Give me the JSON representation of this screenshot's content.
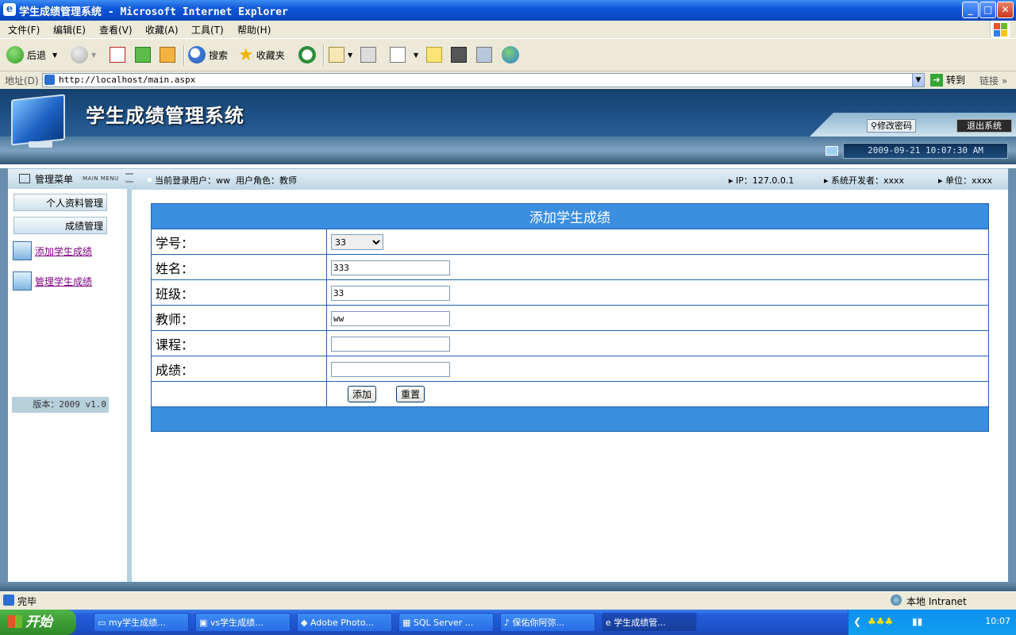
{
  "window": {
    "title": "学生成绩管理系统 - Microsoft Internet Explorer",
    "icon": "ie-icon"
  },
  "window_controls": {
    "minimize": "_",
    "maximize": "□",
    "close": "✕"
  },
  "menubar": {
    "items": [
      "文件(F)",
      "编辑(E)",
      "查看(V)",
      "收藏(A)",
      "工具(T)",
      "帮助(H)"
    ]
  },
  "toolbar": {
    "back": "后退",
    "search": "搜索",
    "favorites": "收藏夹"
  },
  "addressbar": {
    "label": "地址(D)",
    "url": "http://localhost/main.aspx",
    "go": "转到",
    "links": "链接"
  },
  "header": {
    "system_name": "学生成绩管理系统",
    "change_password": "修改密码",
    "exit": "退出系统",
    "datetime": "2009-09-21 10:07:30 AM"
  },
  "infobar": {
    "menu_title": "管理菜单",
    "menu_subtitle": "MAIN MENU",
    "current_user_label": "当前登录用户：",
    "current_user": "ww",
    "role_label": "用户角色：",
    "role": "教师",
    "ip": "IP：127.0.0.1",
    "developer": "系统开发者：xxxx",
    "unit": "单位：xxxx"
  },
  "sidebar": {
    "buttons": [
      "个人资料管理",
      "成绩管理"
    ],
    "links": [
      "添加学生成绩",
      "管理学生成绩"
    ],
    "version": "版本：2009 v1.0"
  },
  "form": {
    "title": "添加学生成绩",
    "fields": [
      {
        "label": "学号：",
        "type": "select",
        "value": "33"
      },
      {
        "label": "姓名：",
        "type": "text",
        "value": "333"
      },
      {
        "label": "班级：",
        "type": "text",
        "value": "33"
      },
      {
        "label": "教师：",
        "type": "text",
        "value": "ww"
      },
      {
        "label": "课程：",
        "type": "text",
        "value": ""
      },
      {
        "label": "成绩：",
        "type": "text",
        "value": ""
      }
    ],
    "add_button": "添加",
    "reset_button": "重置"
  },
  "statusbar": {
    "status": "完毕",
    "zone": "本地 Intranet"
  },
  "taskbar": {
    "start": "开始",
    "tasks": [
      "my学生成绩...",
      "vs学生成绩...",
      "Adobe Photo...",
      "SQL Server ...",
      "保佑你阿弥...",
      "学生成绩管..."
    ],
    "clock": "10:07"
  },
  "colors": {
    "title_blue": "#0a4bc7",
    "header_navy": "#1e5288",
    "form_blue": "#3b8ee0",
    "link_purple": "#800080"
  }
}
